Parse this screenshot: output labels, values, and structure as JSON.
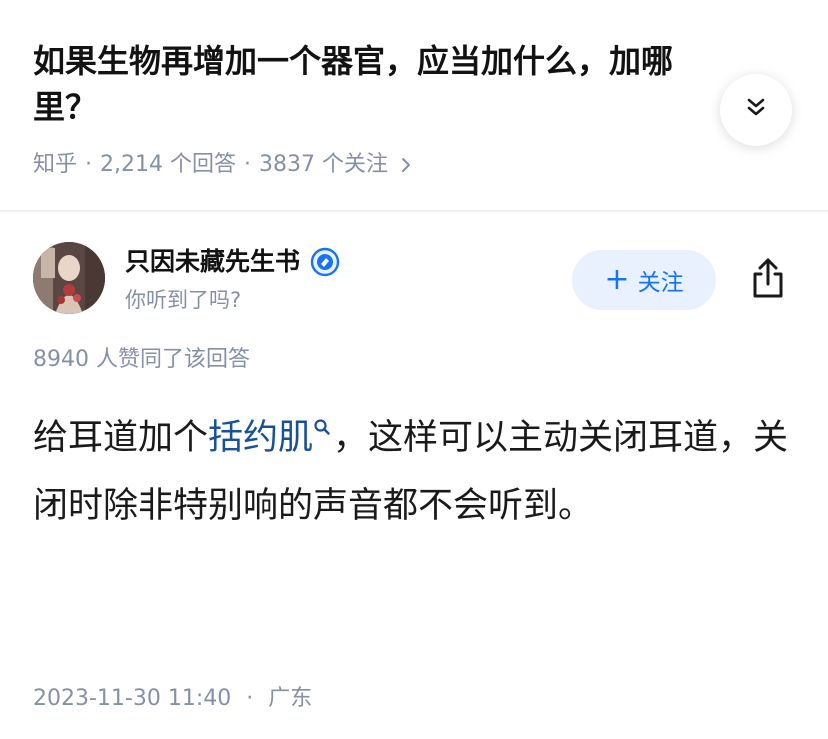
{
  "question": {
    "title": "如果生物再增加一个器官，应当加什么，加哪里？",
    "source": "知乎",
    "answer_count": "2,214 个回答",
    "follower_count": "3837 个关注",
    "separator": "·"
  },
  "author": {
    "name": "只因未藏先生书",
    "bio": "你听到了吗?"
  },
  "actions": {
    "follow_plus": "+",
    "follow_label": "关注"
  },
  "answer": {
    "likes": "8940 人赞同了该回答",
    "text_before": "给耳道加个",
    "link_text": "括约肌",
    "text_after": "，这样可以主动关闭耳道，关闭时除非特别响的声音都不会听到。",
    "date": "2023-11-30 11:40",
    "separator": "·",
    "location": "广东"
  },
  "colors": {
    "accent": "#1772f6",
    "link": "#175199",
    "meta": "#8590a6",
    "follow_bg": "#e9f1fe"
  },
  "icons": {
    "collapse": "double-chevron-down-icon",
    "meta_arrow": "chevron-right-icon",
    "verified": "verified-badge-icon",
    "share": "share-icon",
    "search": "search-icon"
  }
}
